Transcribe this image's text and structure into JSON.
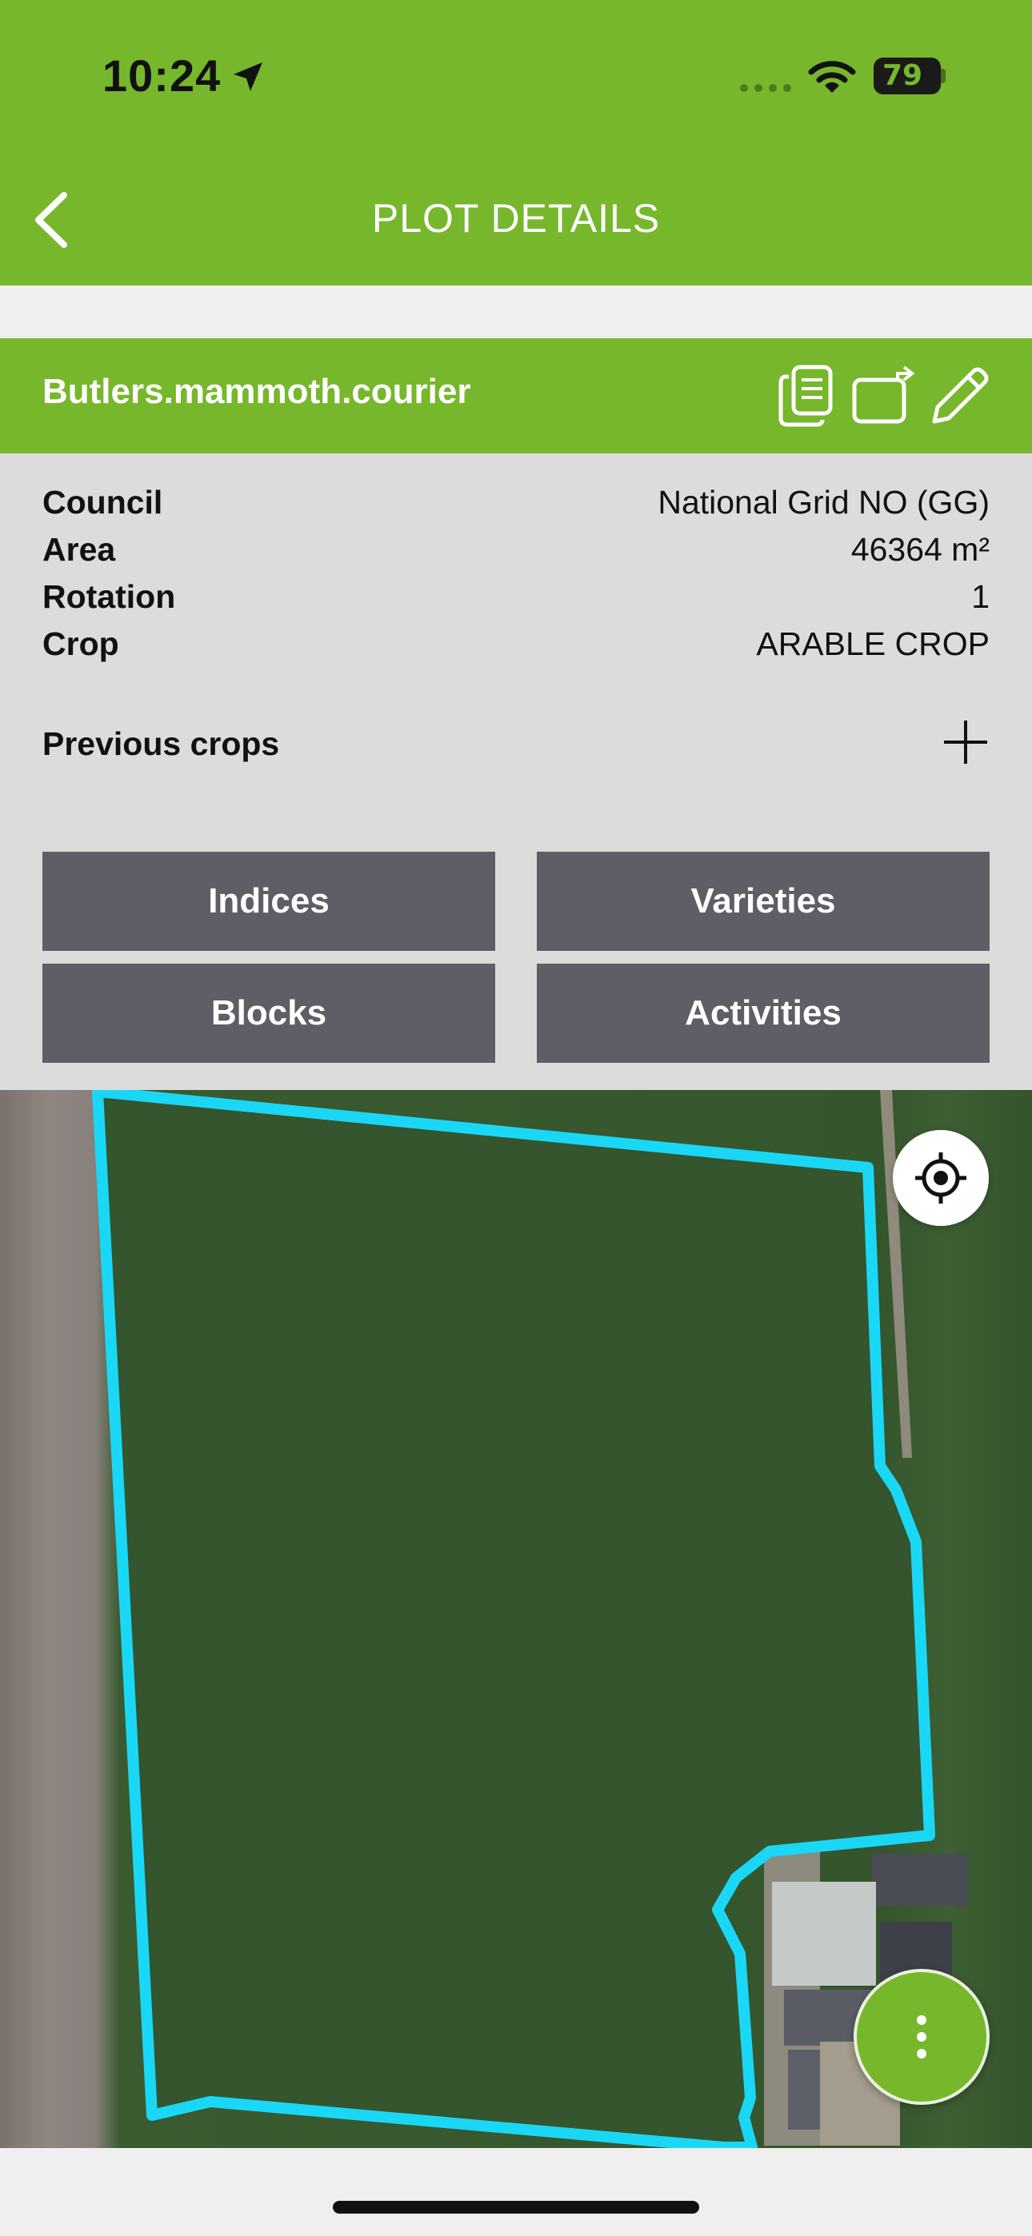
{
  "status_bar": {
    "time": "10:24",
    "battery": "79",
    "icons": [
      "location-arrow-icon",
      "signal-icon",
      "wifi-icon",
      "battery-icon"
    ]
  },
  "nav": {
    "title": "PLOT DETAILS",
    "back_icon": "chevron-left-icon"
  },
  "plot": {
    "name": "Butlers.mammoth.courier",
    "actions": [
      "copy-icon",
      "export-icon",
      "edit-icon"
    ]
  },
  "details": {
    "council_label": "Council",
    "council_value": "National Grid NO (GG)",
    "area_label": "Area",
    "area_value": "46364 m²",
    "rotation_label": "Rotation",
    "rotation_value": "1",
    "crop_label": "Crop",
    "crop_value": "ARABLE CROP",
    "previous_crops_label": "Previous crops"
  },
  "buttons": {
    "indices": "Indices",
    "varieties": "Varieties",
    "blocks": "Blocks",
    "activities": "Activities"
  },
  "map": {
    "boundary_color": "#1ad8f5",
    "field_color": "#34552d",
    "controls": [
      "crosshair-icon",
      "more-vertical-icon"
    ]
  },
  "colors": {
    "brand_green": "#77b72c",
    "button_gray": "#5f5e66",
    "panel_gray": "#dcdcdc"
  }
}
